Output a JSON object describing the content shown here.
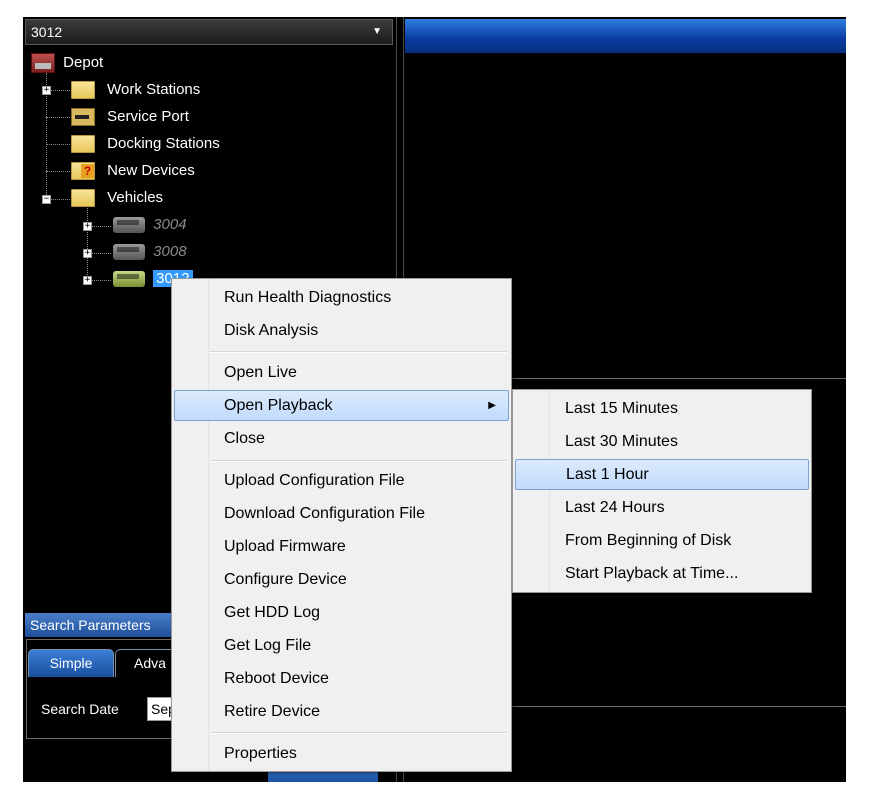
{
  "device_selector": {
    "value": "3012"
  },
  "tree": {
    "root": "Depot",
    "items": [
      {
        "label": "Work Stations"
      },
      {
        "label": "Service Port"
      },
      {
        "label": "Docking Stations"
      },
      {
        "label": "New Devices"
      },
      {
        "label": "Vehicles"
      }
    ],
    "vehicles": [
      {
        "label": "3004",
        "state": "offline"
      },
      {
        "label": "3008",
        "state": "offline"
      },
      {
        "label": "3012",
        "state": "selected"
      }
    ]
  },
  "search_panel": {
    "title": "Search Parameters",
    "tabs": [
      "Simple",
      "Adva"
    ],
    "date_label": "Search Date",
    "date_value": "Sep"
  },
  "context_menu": {
    "items": [
      "Run Health Diagnostics",
      "Disk Analysis",
      "Open Live",
      "Open Playback",
      "Close",
      "Upload Configuration File",
      "Download Configuration File",
      "Upload Firmware",
      "Configure Device",
      "Get HDD Log",
      "Get Log File",
      "Reboot Device",
      "Retire Device",
      "Properties"
    ],
    "highlighted": "Open Playback"
  },
  "playback_submenu": {
    "items": [
      "Last 15 Minutes",
      "Last 30 Minutes",
      "Last 1 Hour",
      "Last 24 Hours",
      "From Beginning of Disk",
      "Start Playback at Time..."
    ],
    "highlighted": "Last 1 Hour"
  }
}
